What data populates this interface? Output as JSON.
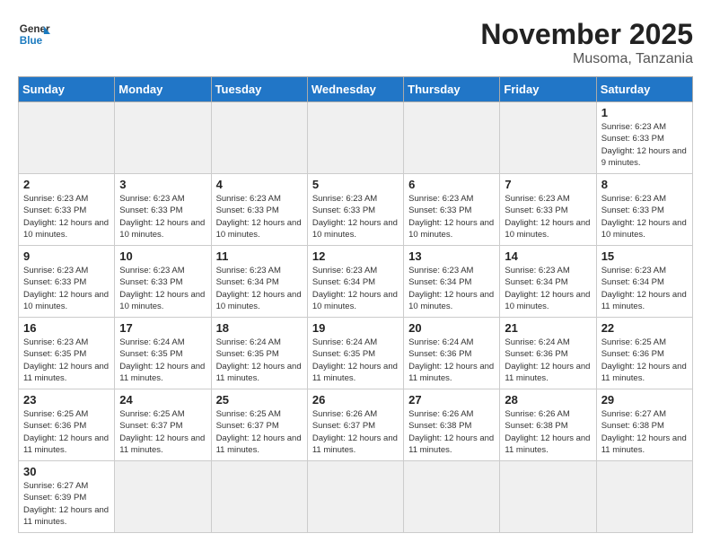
{
  "header": {
    "logo_general": "General",
    "logo_blue": "Blue",
    "month": "November 2025",
    "location": "Musoma, Tanzania"
  },
  "days_of_week": [
    "Sunday",
    "Monday",
    "Tuesday",
    "Wednesday",
    "Thursday",
    "Friday",
    "Saturday"
  ],
  "weeks": [
    [
      {
        "day": "",
        "info": ""
      },
      {
        "day": "",
        "info": ""
      },
      {
        "day": "",
        "info": ""
      },
      {
        "day": "",
        "info": ""
      },
      {
        "day": "",
        "info": ""
      },
      {
        "day": "",
        "info": ""
      },
      {
        "day": "1",
        "info": "Sunrise: 6:23 AM\nSunset: 6:33 PM\nDaylight: 12 hours\nand 9 minutes."
      }
    ],
    [
      {
        "day": "2",
        "info": "Sunrise: 6:23 AM\nSunset: 6:33 PM\nDaylight: 12 hours\nand 10 minutes."
      },
      {
        "day": "3",
        "info": "Sunrise: 6:23 AM\nSunset: 6:33 PM\nDaylight: 12 hours\nand 10 minutes."
      },
      {
        "day": "4",
        "info": "Sunrise: 6:23 AM\nSunset: 6:33 PM\nDaylight: 12 hours\nand 10 minutes."
      },
      {
        "day": "5",
        "info": "Sunrise: 6:23 AM\nSunset: 6:33 PM\nDaylight: 12 hours\nand 10 minutes."
      },
      {
        "day": "6",
        "info": "Sunrise: 6:23 AM\nSunset: 6:33 PM\nDaylight: 12 hours\nand 10 minutes."
      },
      {
        "day": "7",
        "info": "Sunrise: 6:23 AM\nSunset: 6:33 PM\nDaylight: 12 hours\nand 10 minutes."
      },
      {
        "day": "8",
        "info": "Sunrise: 6:23 AM\nSunset: 6:33 PM\nDaylight: 12 hours\nand 10 minutes."
      }
    ],
    [
      {
        "day": "9",
        "info": "Sunrise: 6:23 AM\nSunset: 6:33 PM\nDaylight: 12 hours\nand 10 minutes."
      },
      {
        "day": "10",
        "info": "Sunrise: 6:23 AM\nSunset: 6:33 PM\nDaylight: 12 hours\nand 10 minutes."
      },
      {
        "day": "11",
        "info": "Sunrise: 6:23 AM\nSunset: 6:34 PM\nDaylight: 12 hours\nand 10 minutes."
      },
      {
        "day": "12",
        "info": "Sunrise: 6:23 AM\nSunset: 6:34 PM\nDaylight: 12 hours\nand 10 minutes."
      },
      {
        "day": "13",
        "info": "Sunrise: 6:23 AM\nSunset: 6:34 PM\nDaylight: 12 hours\nand 10 minutes."
      },
      {
        "day": "14",
        "info": "Sunrise: 6:23 AM\nSunset: 6:34 PM\nDaylight: 12 hours\nand 10 minutes."
      },
      {
        "day": "15",
        "info": "Sunrise: 6:23 AM\nSunset: 6:34 PM\nDaylight: 12 hours\nand 11 minutes."
      }
    ],
    [
      {
        "day": "16",
        "info": "Sunrise: 6:23 AM\nSunset: 6:35 PM\nDaylight: 12 hours\nand 11 minutes."
      },
      {
        "day": "17",
        "info": "Sunrise: 6:24 AM\nSunset: 6:35 PM\nDaylight: 12 hours\nand 11 minutes."
      },
      {
        "day": "18",
        "info": "Sunrise: 6:24 AM\nSunset: 6:35 PM\nDaylight: 12 hours\nand 11 minutes."
      },
      {
        "day": "19",
        "info": "Sunrise: 6:24 AM\nSunset: 6:35 PM\nDaylight: 12 hours\nand 11 minutes."
      },
      {
        "day": "20",
        "info": "Sunrise: 6:24 AM\nSunset: 6:36 PM\nDaylight: 12 hours\nand 11 minutes."
      },
      {
        "day": "21",
        "info": "Sunrise: 6:24 AM\nSunset: 6:36 PM\nDaylight: 12 hours\nand 11 minutes."
      },
      {
        "day": "22",
        "info": "Sunrise: 6:25 AM\nSunset: 6:36 PM\nDaylight: 12 hours\nand 11 minutes."
      }
    ],
    [
      {
        "day": "23",
        "info": "Sunrise: 6:25 AM\nSunset: 6:36 PM\nDaylight: 12 hours\nand 11 minutes."
      },
      {
        "day": "24",
        "info": "Sunrise: 6:25 AM\nSunset: 6:37 PM\nDaylight: 12 hours\nand 11 minutes."
      },
      {
        "day": "25",
        "info": "Sunrise: 6:25 AM\nSunset: 6:37 PM\nDaylight: 12 hours\nand 11 minutes."
      },
      {
        "day": "26",
        "info": "Sunrise: 6:26 AM\nSunset: 6:37 PM\nDaylight: 12 hours\nand 11 minutes."
      },
      {
        "day": "27",
        "info": "Sunrise: 6:26 AM\nSunset: 6:38 PM\nDaylight: 12 hours\nand 11 minutes."
      },
      {
        "day": "28",
        "info": "Sunrise: 6:26 AM\nSunset: 6:38 PM\nDaylight: 12 hours\nand 11 minutes."
      },
      {
        "day": "29",
        "info": "Sunrise: 6:27 AM\nSunset: 6:38 PM\nDaylight: 12 hours\nand 11 minutes."
      }
    ],
    [
      {
        "day": "30",
        "info": "Sunrise: 6:27 AM\nSunset: 6:39 PM\nDaylight: 12 hours\nand 11 minutes."
      },
      {
        "day": "",
        "info": ""
      },
      {
        "day": "",
        "info": ""
      },
      {
        "day": "",
        "info": ""
      },
      {
        "day": "",
        "info": ""
      },
      {
        "day": "",
        "info": ""
      },
      {
        "day": "",
        "info": ""
      }
    ]
  ]
}
